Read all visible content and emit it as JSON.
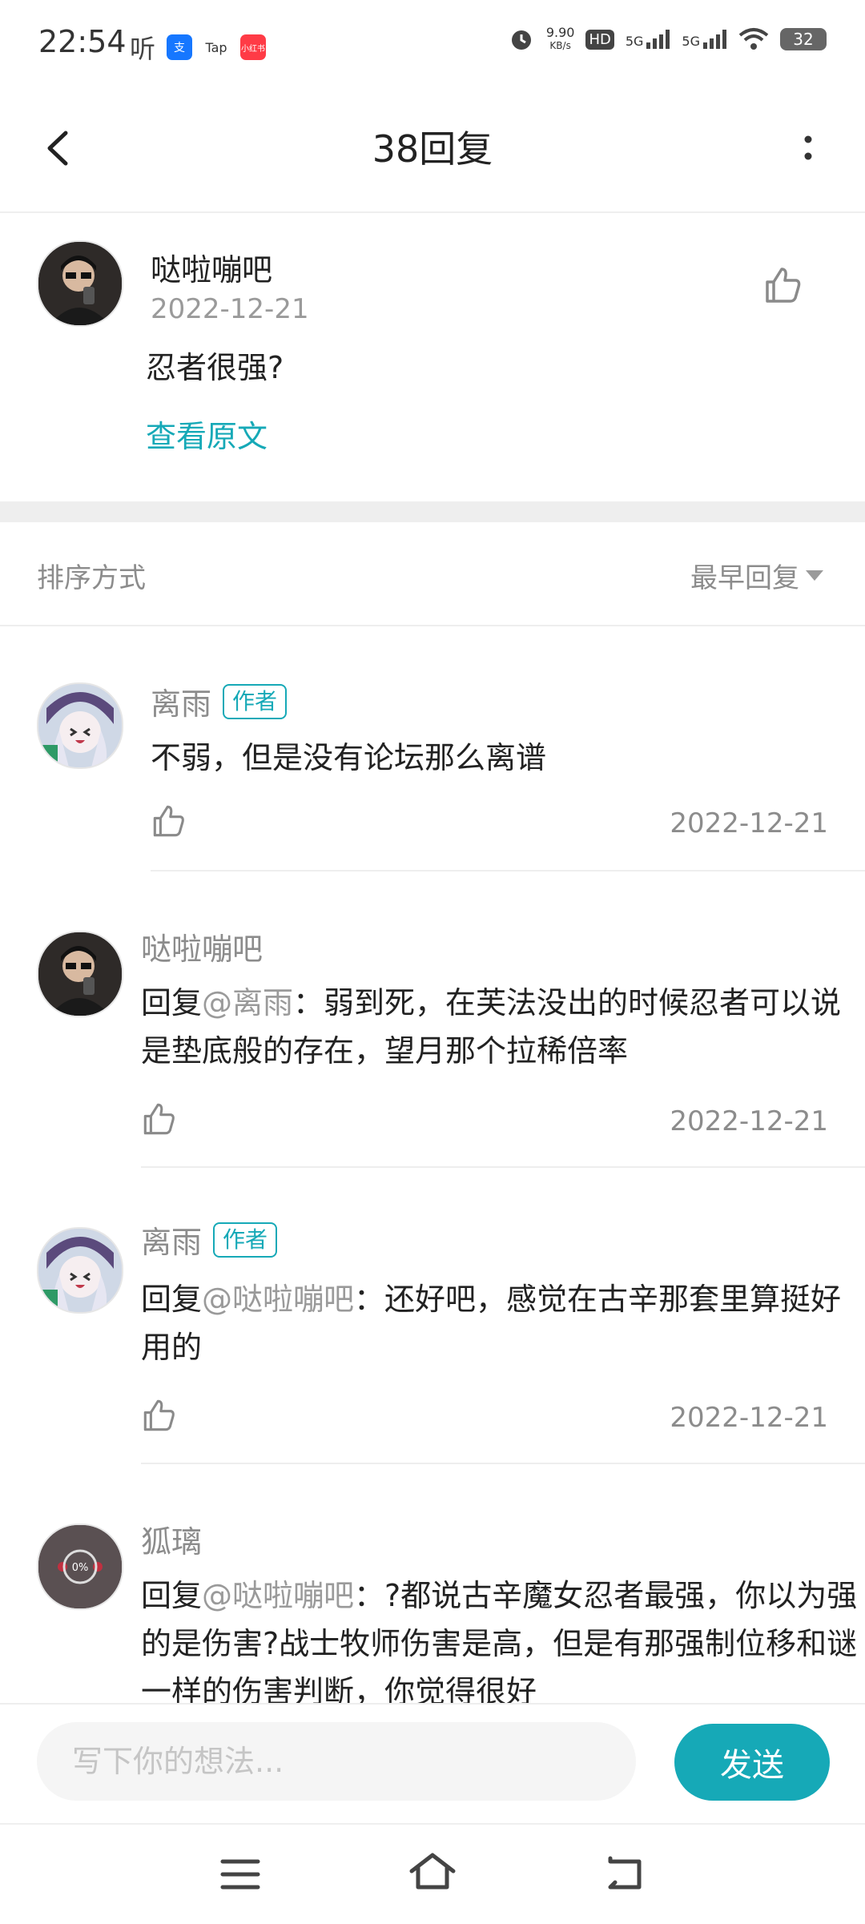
{
  "status_bar": {
    "time": "22:54",
    "left_text": "听",
    "app_icons": [
      "alipay-app-icon",
      "taptap-app-icon",
      "shopping-app-icon"
    ],
    "app_icon_labels": [
      "支",
      "Tap",
      "小红书"
    ],
    "speed_top": "9.90",
    "speed_unit": "KB/s",
    "hd_label": "HD",
    "network_1": "5G",
    "network_2": "5G",
    "battery": "32"
  },
  "header": {
    "title": "38回复"
  },
  "original_post": {
    "user": "哒啦嘣吧",
    "date": "2022-12-21",
    "text": "忍者很强?",
    "view_original": "查看原文"
  },
  "sort": {
    "label": "排序方式",
    "value": "最早回复"
  },
  "replies": [
    {
      "user": "离雨",
      "badge": "作者",
      "prefix": "",
      "mention": "",
      "text": "不弱，但是没有论坛那么离谱",
      "date": "2022-12-21"
    },
    {
      "user": "哒啦嘣吧",
      "badge": "",
      "prefix": "回复",
      "mention": "@离雨",
      "text": "：弱到死，在芙法没出的时候忍者可以说是垫底般的存在，望月那个拉稀倍率",
      "date": "2022-12-21"
    },
    {
      "user": "离雨",
      "badge": "作者",
      "prefix": "回复",
      "mention": "@哒啦嘣吧",
      "text": "：还好吧，感觉在古辛那套里算挺好用的",
      "date": "2022-12-21"
    },
    {
      "user": "狐璃",
      "badge": "",
      "prefix": "回复",
      "mention": "@哒啦嘣吧",
      "text": "：?都说古辛魔女忍者最强，你以为强的是伤害?战士牧师伤害是高，但是有那强制位移和谜一样的伤害判断，你觉得很好",
      "avatar_progress": "0%"
    }
  ],
  "composer": {
    "placeholder": "写下你的想法...",
    "send": "发送"
  },
  "colors": {
    "accent": "#16a9b7",
    "muted_text": "#8c8c8c",
    "divider": "#eeeeee"
  }
}
